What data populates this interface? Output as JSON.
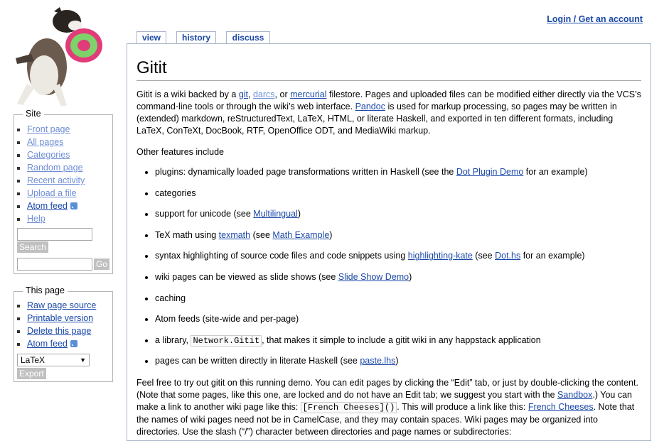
{
  "header": {
    "login_label": "Login / Get an account"
  },
  "tabs": [
    {
      "label": "view",
      "selected": true
    },
    {
      "label": "history",
      "selected": false
    },
    {
      "label": "discuss",
      "selected": false
    }
  ],
  "sidebar": {
    "site": {
      "title": "Site",
      "links": [
        "Front page",
        "All pages",
        "Categories",
        "Random page",
        "Recent activity",
        "Upload a file",
        "Atom feed",
        "Help"
      ],
      "search_button": "Search",
      "go_button": "Go"
    },
    "this_page": {
      "title": "This page",
      "links": [
        "Raw page source",
        "Printable version",
        "Delete this page",
        "Atom feed"
      ],
      "export_selected": "LaTeX",
      "export_button": "Export"
    }
  },
  "page": {
    "title": "Gitit",
    "intro": {
      "t1": "Gitit is a wiki backed by a ",
      "git": "git",
      "t2": ", ",
      "darcs": "darcs",
      "t3": ", or ",
      "mercurial": "mercurial",
      "t4": " filestore. Pages and uploaded files can be modified either directly via the VCS’s command-line tools or through the wiki’s web interface. ",
      "pandoc": "Pandoc",
      "t5": " is used for markup processing, so pages may be written in (extended) markdown, reStructuredText, LaTeX, HTML, or literate Haskell, and exported in ten different formats, including LaTeX, ConTeXt, DocBook, RTF, OpenOffice ODT, and MediaWiki markup."
    },
    "other_features": "Other features include",
    "features": {
      "f1a": "plugins: dynamically loaded page transformations written in Haskell (see the ",
      "f1link": "Dot Plugin Demo",
      "f1b": " for an example)",
      "f2": "categories",
      "f3a": "support for unicode (see ",
      "f3link": "Multilingual",
      "f3b": ")",
      "f4a": "TeX math using ",
      "f4link1": "texmath",
      "f4b": " (see ",
      "f4link2": "Math Example",
      "f4c": ")",
      "f5a": "syntax highlighting of source code files and code snippets using ",
      "f5link1": "highlighting-kate",
      "f5b": " (see ",
      "f5link2": "Dot.hs",
      "f5c": " for an example)",
      "f6a": "wiki pages can be viewed as slide shows (see ",
      "f6link": "Slide Show Demo",
      "f6b": ")",
      "f7": "caching",
      "f8": "Atom feeds (site-wide and per-page)",
      "f9a": "a library, ",
      "f9code": "Network.Gitit",
      "f9b": ", that makes it simple to include a gitit wiki in any happstack application",
      "f10a": "pages can be written directly in literate Haskell (see ",
      "f10link": "paste.lhs",
      "f10b": ")"
    },
    "last": {
      "t1": "Feel free to try out gitit on this running demo. You can edit pages by clicking the “Edit” tab, or just by double-clicking the content. (Note that some pages, like this one, are locked and do not have an Edit tab; we suggest you start with the ",
      "sandbox": "Sandbox",
      "t2": ".) You can make a link to another wiki page like this: ",
      "code": "[French Cheeses]()",
      "t3": ". This will produce a link like this: ",
      "french": "French Cheeses",
      "t4": ". Note that the names of wiki pages need not be in CamelCase, and they may contain spaces. Wiki pages may be organized into directories. Use the slash (“/”) character between directories and page names or subdirectories:"
    }
  }
}
